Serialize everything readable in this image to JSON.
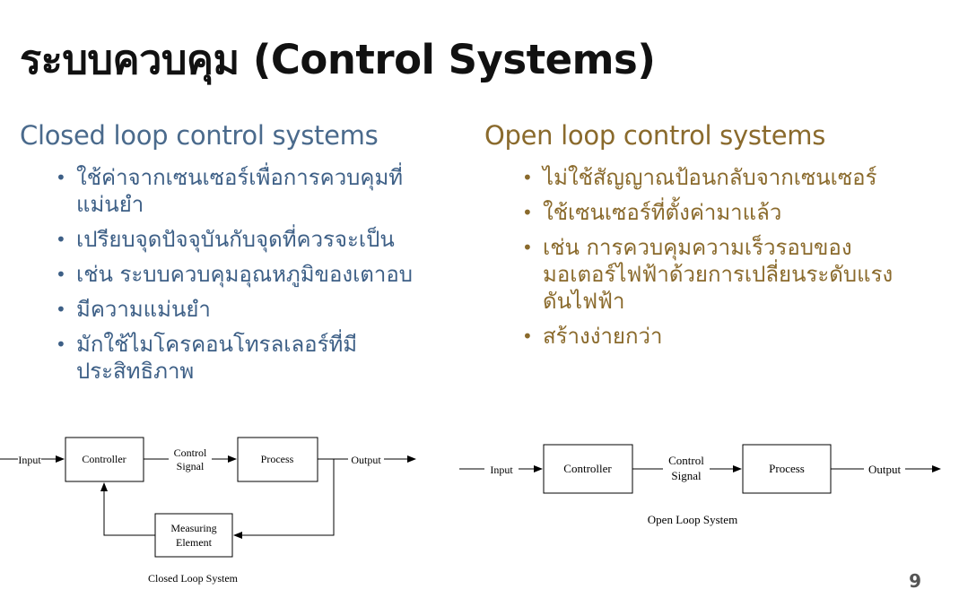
{
  "title": "ระบบควบคุม (Control Systems)",
  "closed_loop": {
    "heading": "Closed loop control systems",
    "bullets": [
      "ใช้ค่าจากเซนเซอร์เพื่อการควบคุมที่แม่นยำ",
      "เปรียบจุดปัจจุบันกับจุดที่ควรจะเป็น",
      "เช่น ระบบควบคุมอุณหภูมิของเตาอบ",
      "มีความแม่นยำ",
      "มักใช้ไมโครคอนโทรลเลอร์ที่มีประสิทธิภาพ"
    ],
    "diagram": {
      "input": "Input",
      "controller": "Controller",
      "control_signal_1": "Control",
      "control_signal_2": "Signal",
      "process": "Process",
      "output": "Output",
      "measuring_1": "Measuring",
      "measuring_2": "Element",
      "caption": "Closed Loop System"
    }
  },
  "open_loop": {
    "heading": "Open loop control systems",
    "bullets": [
      "ไม่ใช้สัญญาณป้อนกลับจากเซนเซอร์",
      "ใช้เซนเซอร์ที่ตั้งค่ามาแล้ว",
      "เช่น การควบคุมความเร็วรอบของมอเตอร์ไฟฟ้าด้วยการเปลี่ยนระดับแรงดันไฟฟ้า",
      "สร้างง่ายกว่า"
    ],
    "diagram": {
      "input": "Input",
      "controller": "Controller",
      "control_signal_1": "Control",
      "control_signal_2": "Signal",
      "process": "Process",
      "output": "Output",
      "caption": "Open Loop System"
    }
  },
  "bullet_char": "•",
  "page_number": "9"
}
